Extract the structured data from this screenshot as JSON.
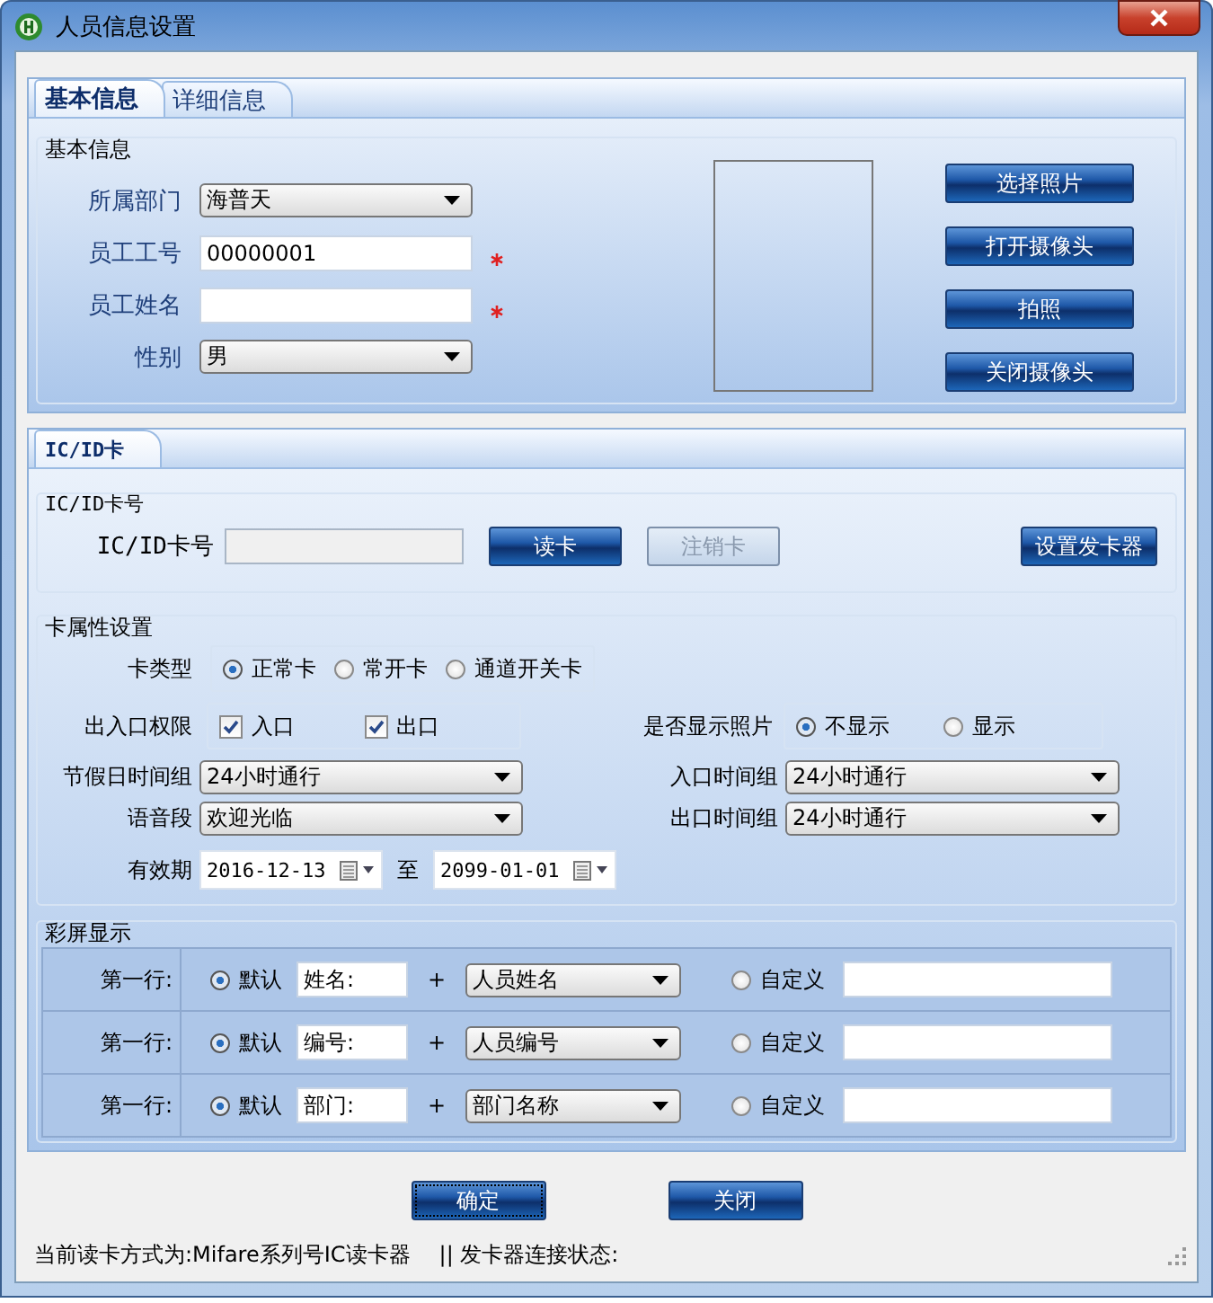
{
  "window": {
    "title": "人员信息设置"
  },
  "tabs": [
    {
      "label": "基本信息",
      "selected": true
    },
    {
      "label": "详细信息",
      "selected": false
    }
  ],
  "basic": {
    "legend": "基本信息",
    "fields": [
      {
        "kind": "select",
        "label": "所属部门",
        "value": "海普天",
        "required": false
      },
      {
        "kind": "text",
        "label": "员工工号",
        "value": "00000001",
        "required": true
      },
      {
        "kind": "text",
        "label": "员工姓名",
        "required": true
      },
      {
        "kind": "select",
        "label": "性别",
        "value": "男",
        "required": false
      }
    ],
    "photo_buttons": [
      "选择照片",
      "打开摄像头",
      "拍照",
      "关闭摄像头"
    ]
  },
  "card_tabs": [
    {
      "label": "IC/ID卡",
      "selected": true
    }
  ],
  "card_number": {
    "legend": "IC/ID卡号",
    "label": "IC/ID卡号",
    "buttons": [
      {
        "label": "读卡",
        "disabled": false
      },
      {
        "label": "注销卡",
        "disabled": true
      }
    ],
    "setup_button": "设置发卡器"
  },
  "card_props": {
    "legend": "卡属性设置",
    "card_type": {
      "label": "卡类型",
      "options": [
        {
          "label": "正常卡",
          "selected": true
        },
        {
          "label": "常开卡",
          "selected": false
        },
        {
          "label": "通道开关卡",
          "selected": false
        }
      ]
    },
    "access": {
      "label": "出入口权限",
      "options": [
        {
          "label": "入口",
          "checked": true
        },
        {
          "label": "出口",
          "checked": true
        }
      ]
    },
    "show_photo": {
      "label": "是否显示照片",
      "options": [
        {
          "label": "不显示",
          "selected": true
        },
        {
          "label": "显示",
          "selected": false
        }
      ]
    },
    "left_selects": [
      {
        "label": "节假日时间组",
        "value": "24小时通行"
      },
      {
        "label": "语音段",
        "value": "欢迎光临"
      }
    ],
    "right_selects": [
      {
        "label": "入口时间组",
        "value": "24小时通行"
      },
      {
        "label": "出口时间组",
        "value": "24小时通行"
      }
    ],
    "validity": {
      "label": "有效期",
      "from": "2016-12-13",
      "separator": "至",
      "to": "2099-01-01"
    }
  },
  "color_screen": {
    "legend": "彩屏显示",
    "rows": [
      {
        "label": "第一行:",
        "options": [
          {
            "label": "默认",
            "selected": true
          },
          {
            "label": "自定义",
            "selected": false
          }
        ],
        "prefix": "姓名:",
        "plus": "+",
        "field": "人员姓名"
      },
      {
        "label": "第一行:",
        "options": [
          {
            "label": "默认",
            "selected": true
          },
          {
            "label": "自定义",
            "selected": false
          }
        ],
        "prefix": "编号:",
        "plus": "+",
        "field": "人员编号"
      },
      {
        "label": "第一行:",
        "options": [
          {
            "label": "默认",
            "selected": true
          },
          {
            "label": "自定义",
            "selected": false
          }
        ],
        "prefix": "部门:",
        "plus": "+",
        "field": "部门名称"
      }
    ]
  },
  "buttons": [
    {
      "label": "确定",
      "focused": true
    },
    {
      "label": "关闭",
      "focused": false
    }
  ],
  "status_bar": {
    "read_mode": "当前读卡方式为:Mifare系列号IC读卡器",
    "connection": "|| 发卡器连接状态:"
  }
}
